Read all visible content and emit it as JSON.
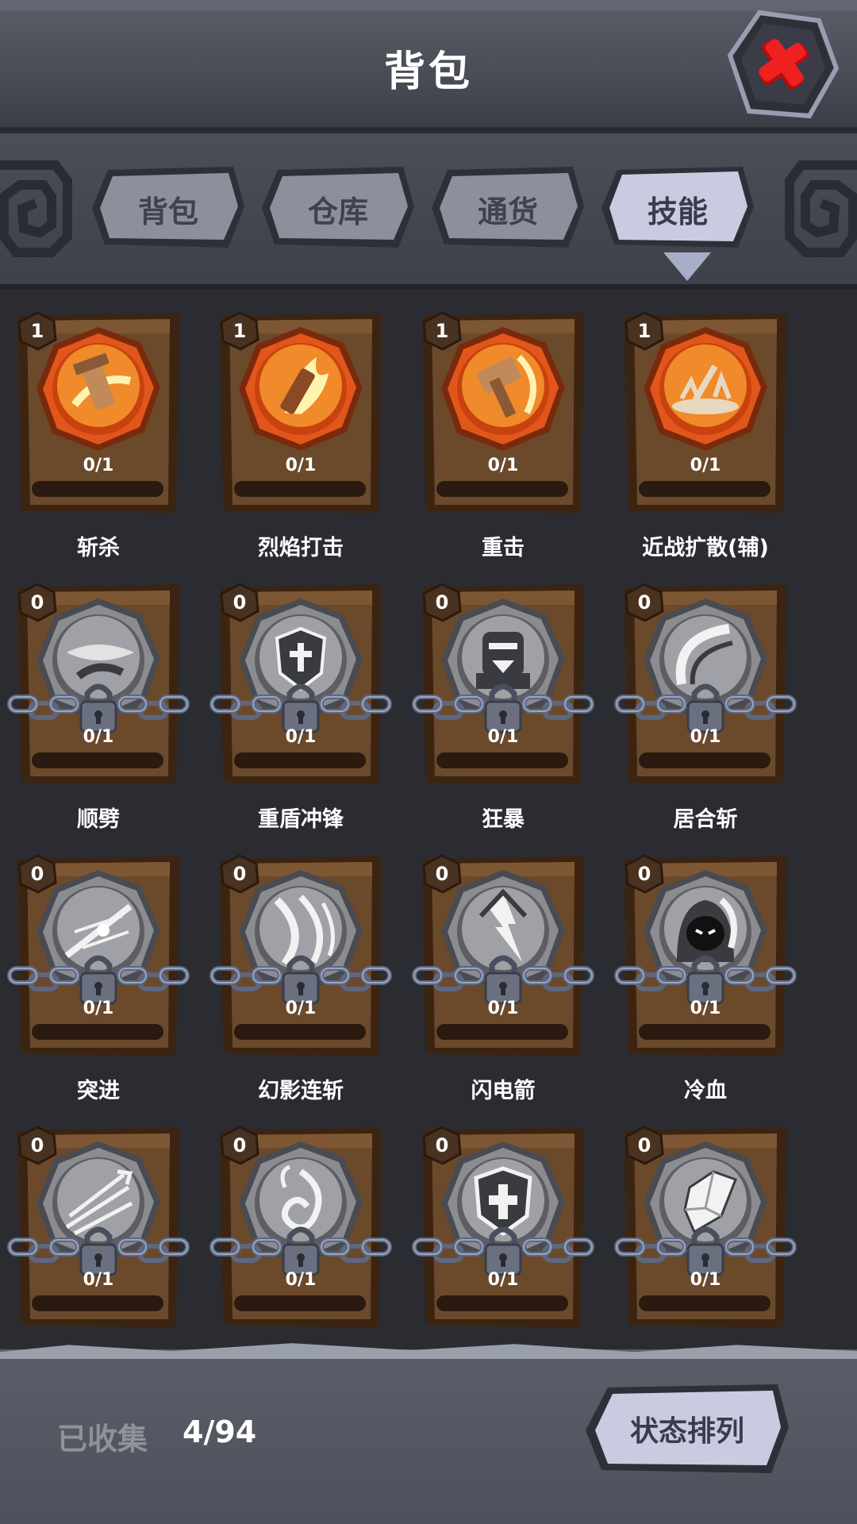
{
  "header": {
    "title": "背包",
    "close_icon": "close-x-icon"
  },
  "tabs": [
    {
      "label": "背包",
      "active": false
    },
    {
      "label": "仓库",
      "active": false
    },
    {
      "label": "通货",
      "active": false
    },
    {
      "label": "技能",
      "active": true
    }
  ],
  "skills": [
    {
      "name": "斩杀",
      "level": "1",
      "progress": "0/1",
      "locked": false,
      "icon": "sword-slash-icon"
    },
    {
      "name": "烈焰打击",
      "level": "1",
      "progress": "0/1",
      "locked": false,
      "icon": "flame-strike-icon"
    },
    {
      "name": "重击",
      "level": "1",
      "progress": "0/1",
      "locked": false,
      "icon": "hammer-smash-icon"
    },
    {
      "name": "近战扩散(辅)",
      "level": "1",
      "progress": "0/1",
      "locked": false,
      "icon": "melee-splash-icon"
    },
    {
      "name": "顺劈",
      "level": "0",
      "progress": "0/1",
      "locked": true,
      "icon": "cleave-icon"
    },
    {
      "name": "重盾冲锋",
      "level": "0",
      "progress": "0/1",
      "locked": true,
      "icon": "shield-charge-icon"
    },
    {
      "name": "狂暴",
      "level": "0",
      "progress": "0/1",
      "locked": true,
      "icon": "berserk-icon"
    },
    {
      "name": "居合斩",
      "level": "0",
      "progress": "0/1",
      "locked": true,
      "icon": "iai-slash-icon"
    },
    {
      "name": "突进",
      "level": "0",
      "progress": "0/1",
      "locked": true,
      "icon": "dash-icon"
    },
    {
      "name": "幻影连斩",
      "level": "0",
      "progress": "0/1",
      "locked": true,
      "icon": "phantom-slash-icon"
    },
    {
      "name": "闪电箭",
      "level": "0",
      "progress": "0/1",
      "locked": true,
      "icon": "lightning-arrow-icon"
    },
    {
      "name": "冷血",
      "level": "0",
      "progress": "0/1",
      "locked": true,
      "icon": "cold-blood-icon"
    },
    {
      "name": "",
      "level": "0",
      "progress": "0/1",
      "locked": true,
      "icon": "multi-arrow-icon"
    },
    {
      "name": "",
      "level": "0",
      "progress": "0/1",
      "locked": true,
      "icon": "fire-spiral-icon"
    },
    {
      "name": "",
      "level": "0",
      "progress": "0/1",
      "locked": true,
      "icon": "holy-shield-icon"
    },
    {
      "name": "",
      "level": "0",
      "progress": "0/1",
      "locked": true,
      "icon": "crystal-icon"
    }
  ],
  "footer": {
    "collected_label": "已收集",
    "collected_value": "4/94",
    "sort_button": "状态排列"
  },
  "colors": {
    "background": "#2b2c31",
    "card_wood": "#6b4a2c",
    "emblem_active": "#e2561c",
    "emblem_locked": "#8a8c90",
    "tab_active": "#c9cce0",
    "tab_inactive": "#8c909c",
    "close_red": "#e01818"
  }
}
